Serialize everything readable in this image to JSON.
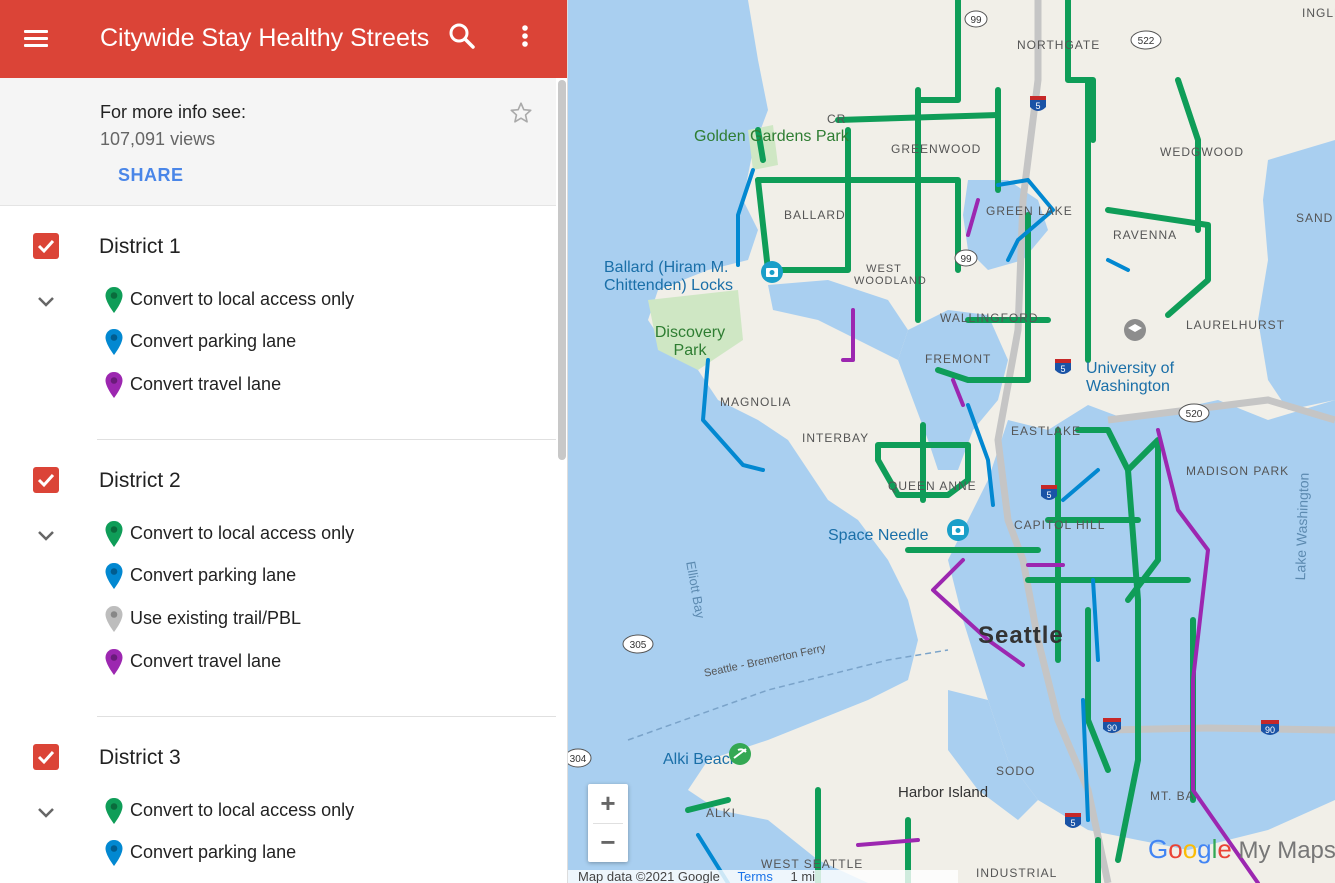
{
  "header": {
    "title": "Citywide Stay Healthy Streets",
    "menu_icon": "menu-icon",
    "search_icon": "search-icon",
    "more_icon": "more-vert-icon",
    "color": "#db4437"
  },
  "info": {
    "label": "For more info see:",
    "views": "107,091 views",
    "share": "SHARE",
    "star_icon": "star-outline-icon"
  },
  "legend_colors": {
    "local_access": "#0f9d58",
    "parking_lane": "#0288d1",
    "existing_trail": "#bdbdbd",
    "travel_lane": "#9c27b0"
  },
  "layers": [
    {
      "name": "District 1",
      "checked": true,
      "items": [
        {
          "label": "Convert to local access only",
          "color": "#0f9d58"
        },
        {
          "label": "Convert parking lane",
          "color": "#0288d1"
        },
        {
          "label": "Convert travel lane",
          "color": "#9c27b0"
        }
      ]
    },
    {
      "name": "District 2",
      "checked": true,
      "items": [
        {
          "label": "Convert to local access only",
          "color": "#0f9d58"
        },
        {
          "label": "Convert parking lane",
          "color": "#0288d1"
        },
        {
          "label": "Use existing trail/PBL",
          "color": "#bdbdbd"
        },
        {
          "label": "Convert travel lane",
          "color": "#9c27b0"
        }
      ]
    },
    {
      "name": "District 3",
      "checked": true,
      "items": [
        {
          "label": "Convert to local access only",
          "color": "#0f9d58"
        },
        {
          "label": "Convert parking lane",
          "color": "#0288d1"
        }
      ]
    }
  ],
  "map": {
    "labels": {
      "golden_gardens": "Golden Gardens Park",
      "ballard_locks": "Ballard (Hiram M. Chittenden) Locks",
      "discovery_park": "Discovery Park",
      "magnolia": "MAGNOLIA",
      "interbay": "INTERBAY",
      "queen_anne": "QUEEN ANNE",
      "space_needle": "Space Needle",
      "seattle": "Seattle",
      "elliott_bay": "Elliott Bay",
      "ferry": "Seattle - Bremerton Ferry",
      "alki_beach": "Alki Beach",
      "alki": "ALKI",
      "harbor_island": "Harbor Island",
      "sodo": "SODO",
      "west_seattle": "WEST SEATTLE",
      "industrial": "INDUSTRIAL",
      "ballard": "BALLARD",
      "greenwood": "GREENWOOD",
      "crown_hill": "CR",
      "northgate": "NORTHGATE",
      "wedgwood": "WEDGWOOD",
      "green_lake": "GREEN LAKE",
      "ravenna": "RAVENNA",
      "laurelhurst": "LAURELHURST",
      "wallingford": "WALLINGFORD",
      "fremont": "FREMONT",
      "university": "University of Washington",
      "eastlake": "EASTLAKE",
      "madison_park": "MADISON PARK",
      "lake_washington": "Lake Washington",
      "capitol_hill": "CAPITOL HILL",
      "mt_baker": "MT. BA",
      "west_woodland": "WEST WOODLAND",
      "ingleside": "INGLE",
      "sand_point": "SAND PO",
      "shields": [
        "99",
        "522",
        "5",
        "99",
        "5",
        "520",
        "305",
        "304",
        "90",
        "90",
        "5",
        "5"
      ]
    },
    "zoom_in": "+",
    "zoom_out": "−",
    "attribution": "Map data ©2021 Google",
    "terms": "Terms",
    "scale": "1 mi",
    "brand": "Google My Maps"
  }
}
